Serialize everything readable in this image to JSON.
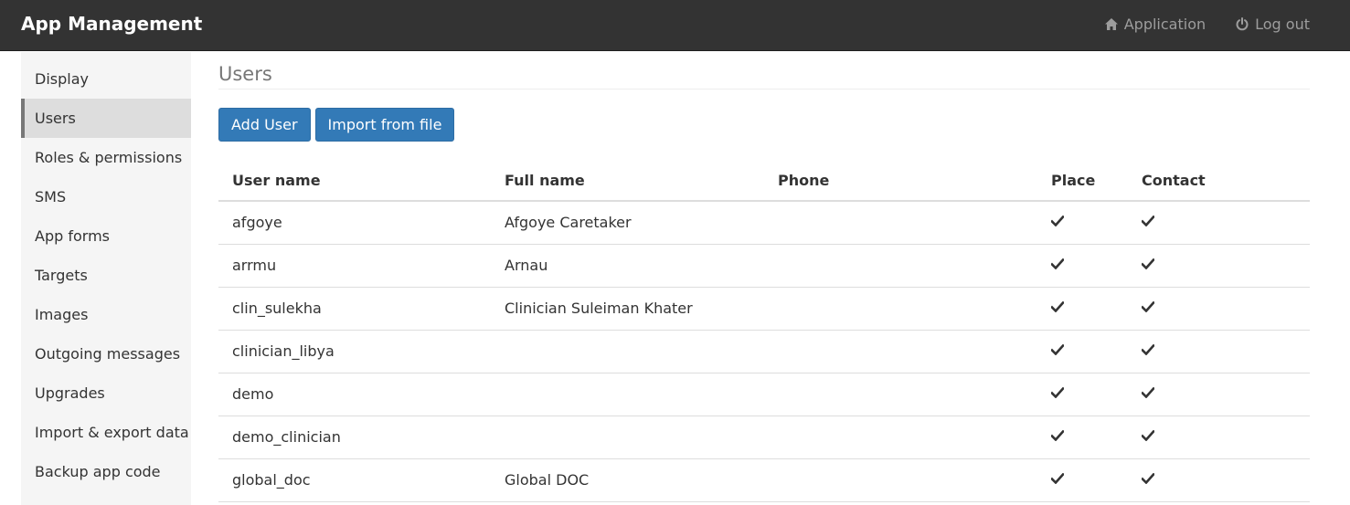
{
  "header": {
    "title": "App Management",
    "nav": [
      {
        "label": "Application",
        "icon": "home-icon"
      },
      {
        "label": "Log out",
        "icon": "power-icon"
      }
    ]
  },
  "sidebar": {
    "items": [
      {
        "label": "Display",
        "active": false
      },
      {
        "label": "Users",
        "active": true
      },
      {
        "label": "Roles & permissions",
        "active": false
      },
      {
        "label": "SMS",
        "active": false
      },
      {
        "label": "App forms",
        "active": false
      },
      {
        "label": "Targets",
        "active": false
      },
      {
        "label": "Images",
        "active": false
      },
      {
        "label": "Outgoing messages",
        "active": false
      },
      {
        "label": "Upgrades",
        "active": false
      },
      {
        "label": "Import & export data",
        "active": false
      },
      {
        "label": "Backup app code",
        "active": false
      }
    ]
  },
  "main": {
    "title": "Users",
    "add_user_label": "Add User",
    "import_label": "Import from file",
    "table": {
      "columns": [
        "User name",
        "Full name",
        "Phone",
        "Place",
        "Contact"
      ],
      "rows": [
        {
          "username": "afgoye",
          "full_name": "Afgoye Caretaker",
          "phone": "",
          "place": true,
          "contact": true
        },
        {
          "username": "arrmu",
          "full_name": "Arnau",
          "phone": "",
          "place": true,
          "contact": true
        },
        {
          "username": "clin_sulekha",
          "full_name": "Clinician Suleiman Khater",
          "phone": "",
          "place": true,
          "contact": true
        },
        {
          "username": "clinician_libya",
          "full_name": "",
          "phone": "",
          "place": true,
          "contact": true
        },
        {
          "username": "demo",
          "full_name": "",
          "phone": "",
          "place": true,
          "contact": true
        },
        {
          "username": "demo_clinician",
          "full_name": "",
          "phone": "",
          "place": true,
          "contact": true
        },
        {
          "username": "global_doc",
          "full_name": "Global DOC",
          "phone": "",
          "place": true,
          "contact": true
        }
      ]
    }
  },
  "colors": {
    "topbar_bg": "#333333",
    "primary_button": "#337ab7",
    "sidebar_bg": "#f5f5f5",
    "sidebar_active_bg": "#dddddd"
  }
}
